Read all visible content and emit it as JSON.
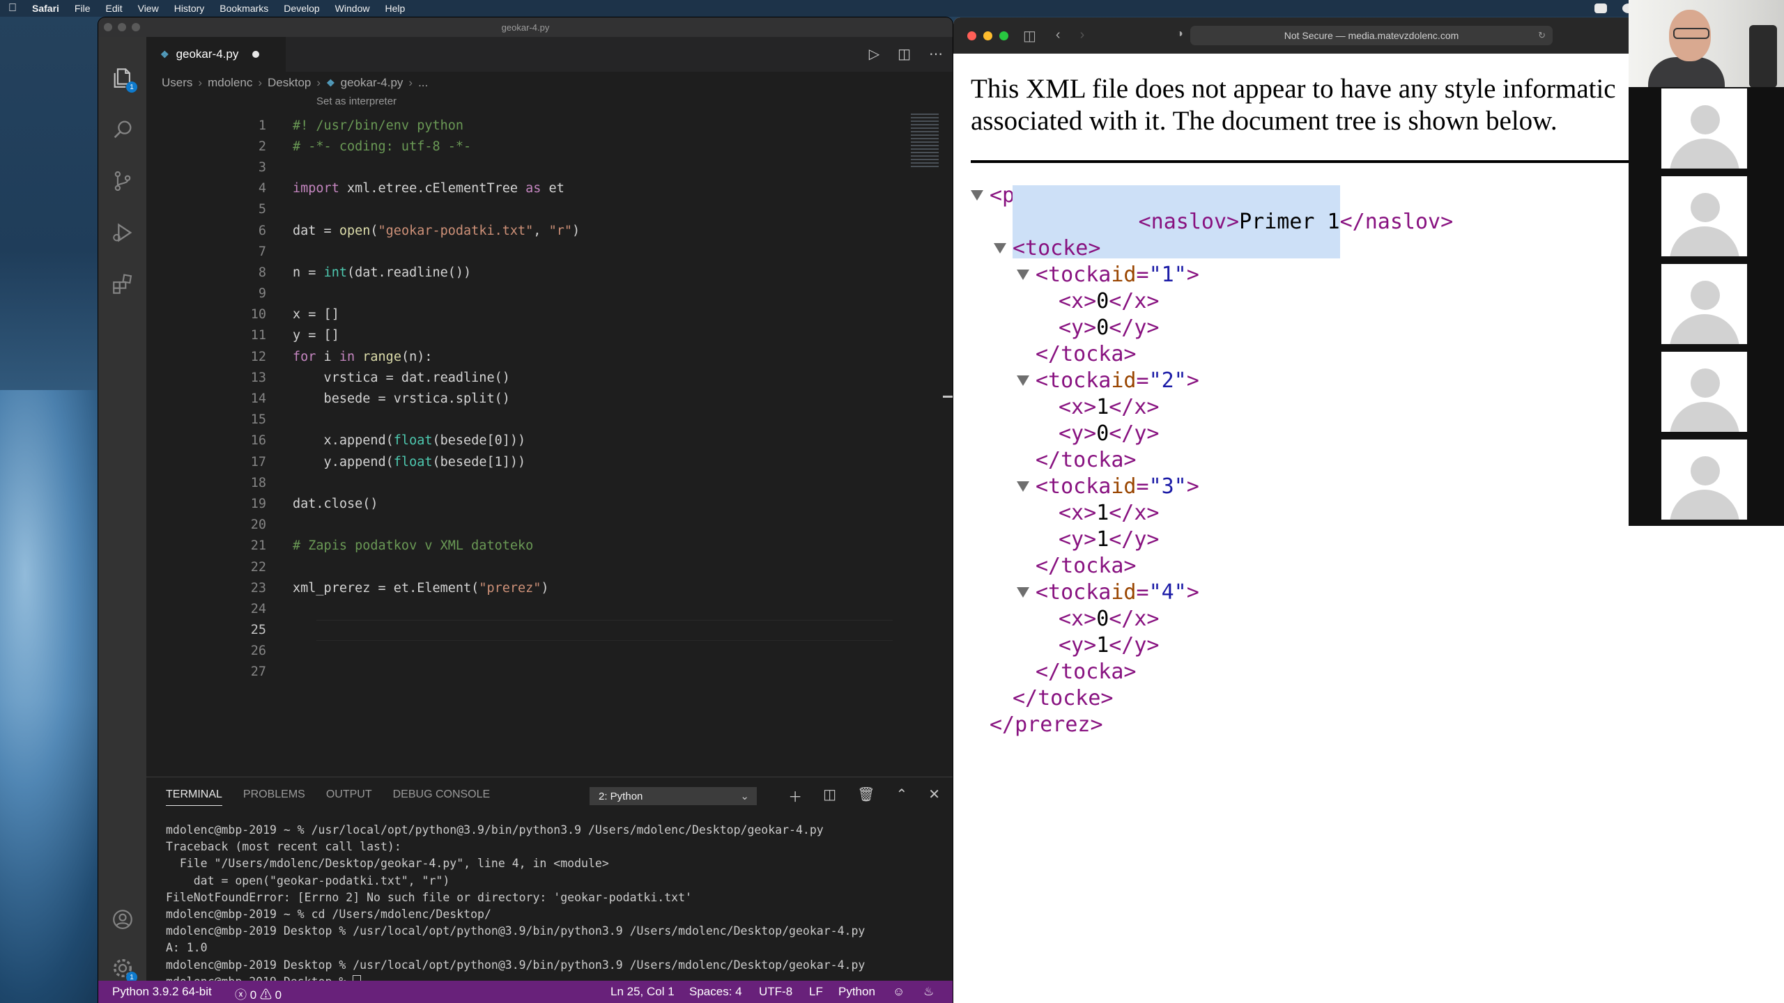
{
  "menubar": {
    "app": "Safari",
    "items": [
      "File",
      "Edit",
      "View",
      "History",
      "Bookmarks",
      "Develop",
      "Window",
      "Help"
    ]
  },
  "vscode": {
    "window_title": "geokar-4.py",
    "tab": {
      "label": "geokar-4.py",
      "modified": true
    },
    "breadcrumb": [
      "Users",
      "mdolenc",
      "Desktop",
      "geokar-4.py",
      "..."
    ],
    "codelens": "Set as interpreter",
    "code_lines": [
      {
        "n": "1",
        "segs": [
          [
            "cm",
            "#! /usr/bin/env python"
          ]
        ]
      },
      {
        "n": "2",
        "segs": [
          [
            "cm",
            "# -*- coding: utf-8 -*-"
          ]
        ]
      },
      {
        "n": "3",
        "segs": []
      },
      {
        "n": "4",
        "segs": [
          [
            "kw",
            "import"
          ],
          [
            "pl",
            " xml.etree.cElementTree "
          ],
          [
            "kw",
            "as"
          ],
          [
            "pl",
            " et"
          ]
        ]
      },
      {
        "n": "5",
        "segs": []
      },
      {
        "n": "6",
        "segs": [
          [
            "pl",
            "dat = "
          ],
          [
            "fn",
            "open"
          ],
          [
            "pl",
            "("
          ],
          [
            "str",
            "\"geokar-podatki.txt\""
          ],
          [
            "pl",
            ", "
          ],
          [
            "str",
            "\"r\""
          ],
          [
            "pl",
            ")"
          ]
        ]
      },
      {
        "n": "7",
        "segs": []
      },
      {
        "n": "8",
        "segs": [
          [
            "pl",
            "n = "
          ],
          [
            "bi",
            "int"
          ],
          [
            "pl",
            "(dat.readline())"
          ]
        ]
      },
      {
        "n": "9",
        "segs": []
      },
      {
        "n": "10",
        "segs": [
          [
            "pl",
            "x = []"
          ]
        ]
      },
      {
        "n": "11",
        "segs": [
          [
            "pl",
            "y = []"
          ]
        ]
      },
      {
        "n": "12",
        "segs": [
          [
            "kw",
            "for"
          ],
          [
            "pl",
            " i "
          ],
          [
            "kw",
            "in"
          ],
          [
            "pl",
            " "
          ],
          [
            "fn",
            "range"
          ],
          [
            "pl",
            "(n):"
          ]
        ]
      },
      {
        "n": "13",
        "segs": [
          [
            "pl",
            "    vrstica = dat.readline()"
          ]
        ]
      },
      {
        "n": "14",
        "segs": [
          [
            "pl",
            "    besede = vrstica.split()"
          ]
        ]
      },
      {
        "n": "15",
        "segs": []
      },
      {
        "n": "16",
        "segs": [
          [
            "pl",
            "    x.append("
          ],
          [
            "bi",
            "float"
          ],
          [
            "pl",
            "(besede[0]))"
          ]
        ]
      },
      {
        "n": "17",
        "segs": [
          [
            "pl",
            "    y.append("
          ],
          [
            "bi",
            "float"
          ],
          [
            "pl",
            "(besede[1]))"
          ]
        ]
      },
      {
        "n": "18",
        "segs": []
      },
      {
        "n": "19",
        "segs": [
          [
            "pl",
            "dat.close()"
          ]
        ]
      },
      {
        "n": "20",
        "segs": []
      },
      {
        "n": "21",
        "segs": [
          [
            "cm",
            "# Zapis podatkov v XML datoteko"
          ]
        ]
      },
      {
        "n": "22",
        "segs": []
      },
      {
        "n": "23",
        "segs": [
          [
            "pl",
            "xml_prerez = et.Element("
          ],
          [
            "str",
            "\"prerez\""
          ],
          [
            "pl",
            ")"
          ]
        ]
      },
      {
        "n": "24",
        "segs": []
      },
      {
        "n": "25",
        "segs": [],
        "active": true
      },
      {
        "n": "26",
        "segs": []
      },
      {
        "n": "27",
        "segs": []
      }
    ],
    "panel": {
      "tabs": [
        "TERMINAL",
        "PROBLEMS",
        "OUTPUT",
        "DEBUG CONSOLE"
      ],
      "terminal_select": "2: Python",
      "lines": [
        "mdolenc@mbp-2019 ~ % /usr/local/opt/python@3.9/bin/python3.9 /Users/mdolenc/Desktop/geokar-4.py",
        "Traceback (most recent call last):",
        "  File \"/Users/mdolenc/Desktop/geokar-4.py\", line 4, in <module>",
        "    dat = open(\"geokar-podatki.txt\", \"r\")",
        "FileNotFoundError: [Errno 2] No such file or directory: 'geokar-podatki.txt'",
        "mdolenc@mbp-2019 ~ % cd /Users/mdolenc/Desktop/",
        "mdolenc@mbp-2019 Desktop % /usr/local/opt/python@3.9/bin/python3.9 /Users/mdolenc/Desktop/geokar-4.py",
        "A: 1.0",
        "mdolenc@mbp-2019 Desktop % /usr/local/opt/python@3.9/bin/python3.9 /Users/mdolenc/Desktop/geokar-4.py"
      ],
      "prompt": "mdolenc@mbp-2019 Desktop % "
    },
    "status": {
      "interpreter": "Python 3.9.2 64-bit",
      "errors": "0",
      "warnings": "0",
      "position": "Ln 25, Col 1",
      "spaces": "Spaces: 4",
      "encoding": "UTF-8",
      "eol": "LF",
      "language": "Python",
      "accent": "#68217a"
    },
    "activity_badges": {
      "explorer": "1",
      "settings": "1"
    }
  },
  "safari": {
    "address": "Not Secure — media.matevzdolenc.com",
    "notice_line1": "This XML file does not appear to have any style informatic",
    "notice_line2": "associated with it. The document tree is shown below.",
    "tree": {
      "root_open": "<prerez>",
      "naslov_open": "<naslov>",
      "naslov_text": "Primer 1",
      "naslov_close": "</naslov>",
      "tocke_open": "<tocke>",
      "tocka_name": "<tocka",
      "id_attr": "id",
      "points": [
        {
          "id": "\"1\"",
          "x": "0",
          "y": "0"
        },
        {
          "id": "\"2\"",
          "x": "1",
          "y": "0"
        },
        {
          "id": "\"3\"",
          "x": "1",
          "y": "1"
        },
        {
          "id": "\"4\"",
          "x": "0",
          "y": "1"
        }
      ],
      "x_open": "<x>",
      "x_close": "</x>",
      "y_open": "<y>",
      "y_close": "</y>",
      "tocka_close": "</tocka>",
      "tocke_close": "</tocke>",
      "root_close": "</prerez>"
    }
  }
}
